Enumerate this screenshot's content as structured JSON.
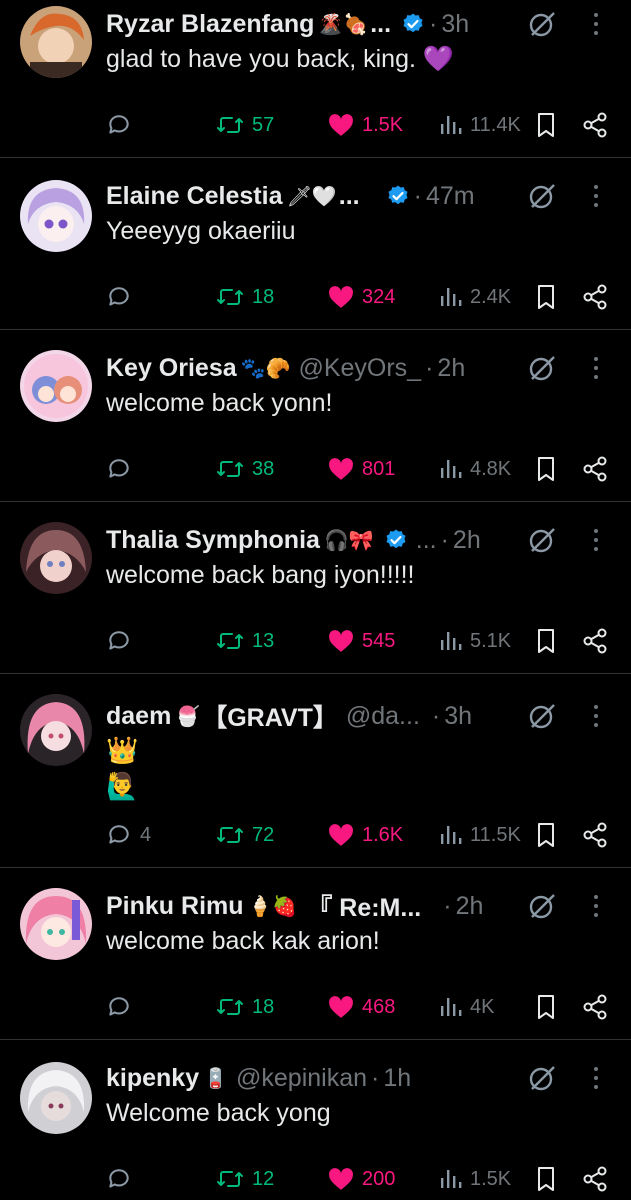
{
  "colors": {
    "background": "#000000",
    "text": "#e7e9ea",
    "muted": "#71767b",
    "repost": "#00ba7c",
    "like": "#f91880",
    "verified": "#1d9bf0",
    "divider": "#2f3336"
  },
  "icons": {
    "reply": "reply-icon",
    "repost": "repost-icon",
    "like": "heart-filled-icon",
    "views": "views-icon",
    "bookmark": "bookmark-icon",
    "share": "share-icon",
    "grok": "grok-icon",
    "more": "more-icon",
    "verified": "verified-badge-icon"
  },
  "posts": [
    {
      "name": "Ryzar Blazenfang",
      "name_emoji": "🌋🍖",
      "name_suffix": "...",
      "handle": "",
      "verified": true,
      "time": "3h",
      "text": "glad to have you back, king. 💜",
      "replies": "",
      "reposts": "57",
      "likes": "1.5K",
      "views": "11.4K"
    },
    {
      "name": "Elaine Celestia",
      "name_emoji": "🗡🤍",
      "name_suffix": "...",
      "handle": "",
      "verified": true,
      "time": "47m",
      "text": "Yeeeyyg okaeriiu",
      "replies": "",
      "reposts": "18",
      "likes": "324",
      "views": "2.4K"
    },
    {
      "name": "Key Oriesa",
      "name_emoji": "🐾🥐",
      "name_suffix": "",
      "handle": "@KeyOrs_",
      "verified": false,
      "time": "2h",
      "text": "welcome back yonn!",
      "replies": "",
      "reposts": "38",
      "likes": "801",
      "views": "4.8K"
    },
    {
      "name": "Thalia Symphonia",
      "name_emoji": "🎧🎀",
      "name_suffix": "",
      "handle": "...",
      "verified": true,
      "time": "2h",
      "text": "welcome back bang iyon!!!!!",
      "replies": "",
      "reposts": "13",
      "likes": "545",
      "views": "5.1K"
    },
    {
      "name": "daem",
      "name_emoji": "🍧",
      "name_suffix": "【GRAVT】",
      "handle": "@da...",
      "verified": false,
      "time": "3h",
      "emoji_lines": [
        "👑",
        "🙋‍♂️"
      ],
      "text": "",
      "replies": "4",
      "reposts": "72",
      "likes": "1.6K",
      "views": "11.5K"
    },
    {
      "name": "Pinku Rimu",
      "name_emoji": "🍦🍓",
      "name_suffix": "『 Re:M...",
      "handle": "",
      "verified": false,
      "time": "2h",
      "text": "welcome back kak arion!",
      "replies": "",
      "reposts": "18",
      "likes": "468",
      "views": "4K"
    },
    {
      "name": "kipenky",
      "name_emoji": "🪫",
      "name_suffix": "",
      "handle": "@kepinikan",
      "verified": false,
      "time": "1h",
      "text": "Welcome back yong",
      "replies": "",
      "reposts": "12",
      "likes": "200",
      "views": "1.5K"
    }
  ]
}
